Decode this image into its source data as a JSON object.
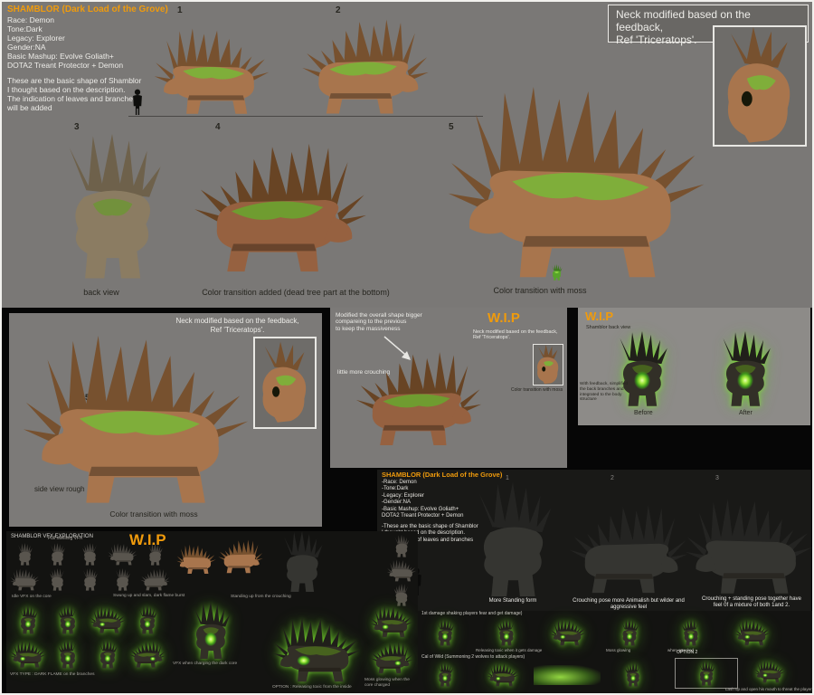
{
  "top": {
    "title": "SHAMBLOR (Dark Load of the Grove)",
    "info": [
      "Race: Demon",
      "Tone:Dark",
      "Legacy: Explorer",
      "Gender:NA",
      "Basic Mashup: Evolve Goliath+",
      "DOTA2 Treant Protector + Demon"
    ],
    "desc": [
      "These are the basic shape of Shamblor",
      "I thought based on the description.",
      "The indication of leaves and branches",
      "will be added"
    ],
    "num1": "1",
    "num2": "2",
    "num3": "3",
    "num4": "4",
    "num5": "5",
    "callout_line1": "Neck modified based on the feedback,",
    "callout_line2": "Ref 'Triceratops'.",
    "caption_back": "back view",
    "caption_color": "Color transition added (dead tree part at the bottom)",
    "caption_moss": "Color transition with moss"
  },
  "mid_left": {
    "callout_line1": "Neck modified based on the feedback,",
    "callout_line2": "Ref 'Triceratops'.",
    "num": "5",
    "caption_side": "side view rough",
    "caption_moss": "Color transition with moss"
  },
  "mid_center": {
    "note1": [
      "Modified the overall shape bigger",
      "compareing to the previous",
      "to keep the massiveness"
    ],
    "note2": "little more crouching",
    "wip": "W.I.P",
    "callout_line1": "Neck modified based on the feedback,",
    "callout_line2": "Ref 'Triceratops'.",
    "frame_caption": "Color transition with moss"
  },
  "mid_right": {
    "wip": "W.I.P",
    "subtitle": "Shamblor back view",
    "note": "With feedback, simplified the back branches and integrated to the body structure",
    "before": "Before",
    "after": "After"
  },
  "poses": {
    "title": "SHAMBLOR (Dark Load of the Grove)",
    "info": [
      "-Race: Demon",
      "-Tone:Dark",
      "-Legacy: Explorer",
      "-Gender:NA",
      "-Basic Mashup: Evolve Goliath+",
      "DOTA2 Treant Protector + Demon"
    ],
    "desc": [
      "-These are the basic shape of Shamblor",
      "I thought based on the description.",
      "The indication of leaves and branches",
      "will be added"
    ],
    "num1": "1",
    "num2": "2",
    "num3": "3",
    "cap1": "More Standing form",
    "cap2": "Crouching pose more Animalish but wilder and aggressive feel",
    "cap3": "Crouching + standing pose together  have feel 0f a mixture of both 1and 2."
  },
  "vfx": {
    "title": "SHAMBLOR VFX EXPLORATION",
    "wip": "W.I.P",
    "n1": "Full swelling VFX",
    "n2": "Swung up and slam, dark flame burst",
    "n3": "Idle VFX on the core",
    "n4": "Standing up from the crouching",
    "n5": "VFX when charging the dark core",
    "n6": "OPTION : Releasing toxic from the inside",
    "n7": "VFX TYPE : DARK FLAME on the branches",
    "n8": "Moss glowing when the core charged"
  },
  "actions": {
    "cap1": "1st damage shaking players fear and get damage)",
    "cap2": "Releasing toxic when it gets damage",
    "cap3": "Moss glowing",
    "cap4": "when attacked",
    "cap5": "Cal of Wild (Summoning 2 wolves to attack players)",
    "option2": "OPTION 2",
    "cap6": "Lash up and open his mouth to threat the player"
  }
}
